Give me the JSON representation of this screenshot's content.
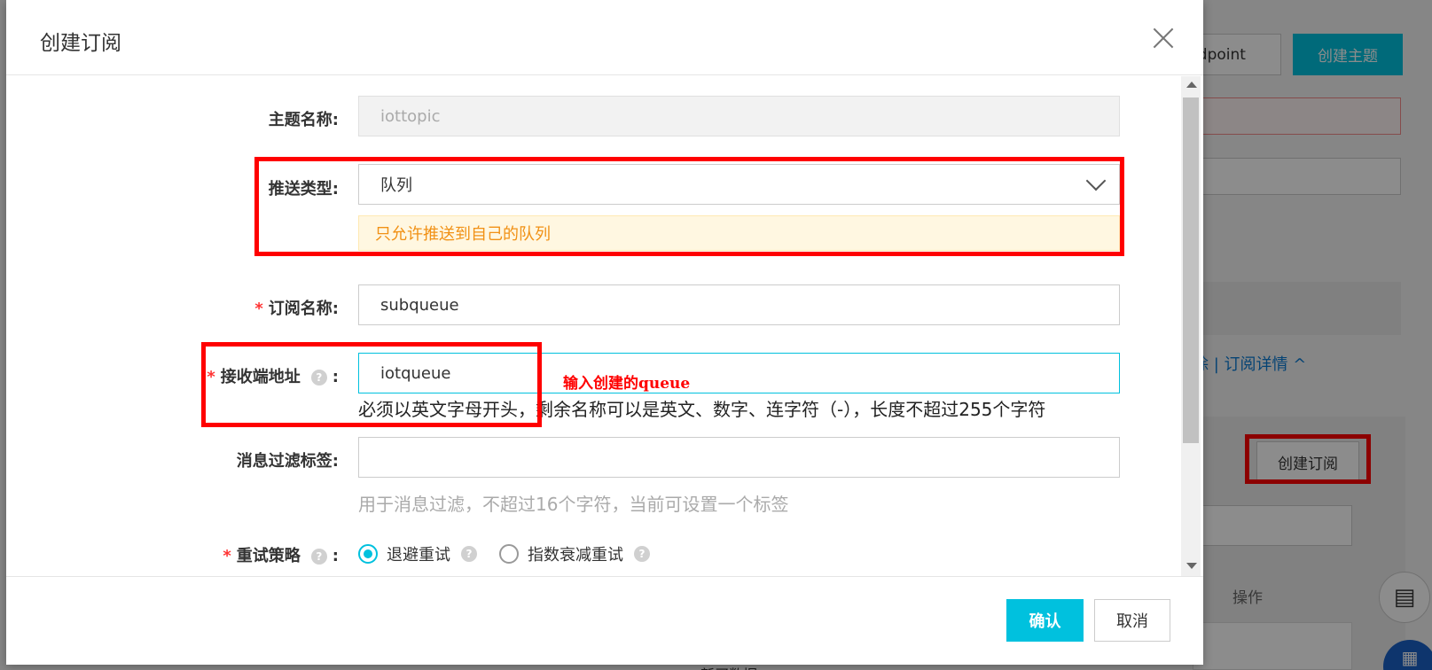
{
  "background": {
    "endpoint_button": "ndpoint",
    "create_topic_button": "创建主题",
    "links": "除 | 订阅详情 ^",
    "create_subscription_button": "创建订阅",
    "ops_header": "操作",
    "chat_icon": "chat-icon",
    "fab_icon": "apps-icon",
    "bottom_text": "新买数据"
  },
  "modal": {
    "title": "创建订阅",
    "close_icon": "close-icon",
    "fields": {
      "topic_name": {
        "label": "主题名称:",
        "value": "iottopic"
      },
      "push_type": {
        "label": "推送类型:",
        "value": "队列",
        "notice": "只允许推送到自己的队列"
      },
      "subscription_name": {
        "label": "订阅名称:",
        "value": "subqueue"
      },
      "endpoint": {
        "label": "接收端地址",
        "suffix": ":",
        "value": "iotqueue",
        "hint": "必须以英文字母开头，剩余名称可以是英文、数字、连字符（-），长度不超过255个字符"
      },
      "filter_tag": {
        "label": "消息过滤标签:",
        "value": "",
        "hint": "用于消息过滤，不超过16个字符，当前可设置一个标签"
      },
      "retry_policy": {
        "label": "重试策略",
        "suffix": ":",
        "options": [
          "退避重试",
          "指数衰减重试"
        ],
        "selected": "退避重试"
      }
    },
    "required_mark": "*",
    "help_glyph": "?",
    "annotation_text": "输入创建的queue",
    "buttons": {
      "confirm": "确认",
      "cancel": "取消"
    }
  },
  "colors": {
    "accent": "#00c1de",
    "annotation": "#ff0000",
    "notice_text": "#f19115",
    "notice_bg": "#fff7e1"
  }
}
